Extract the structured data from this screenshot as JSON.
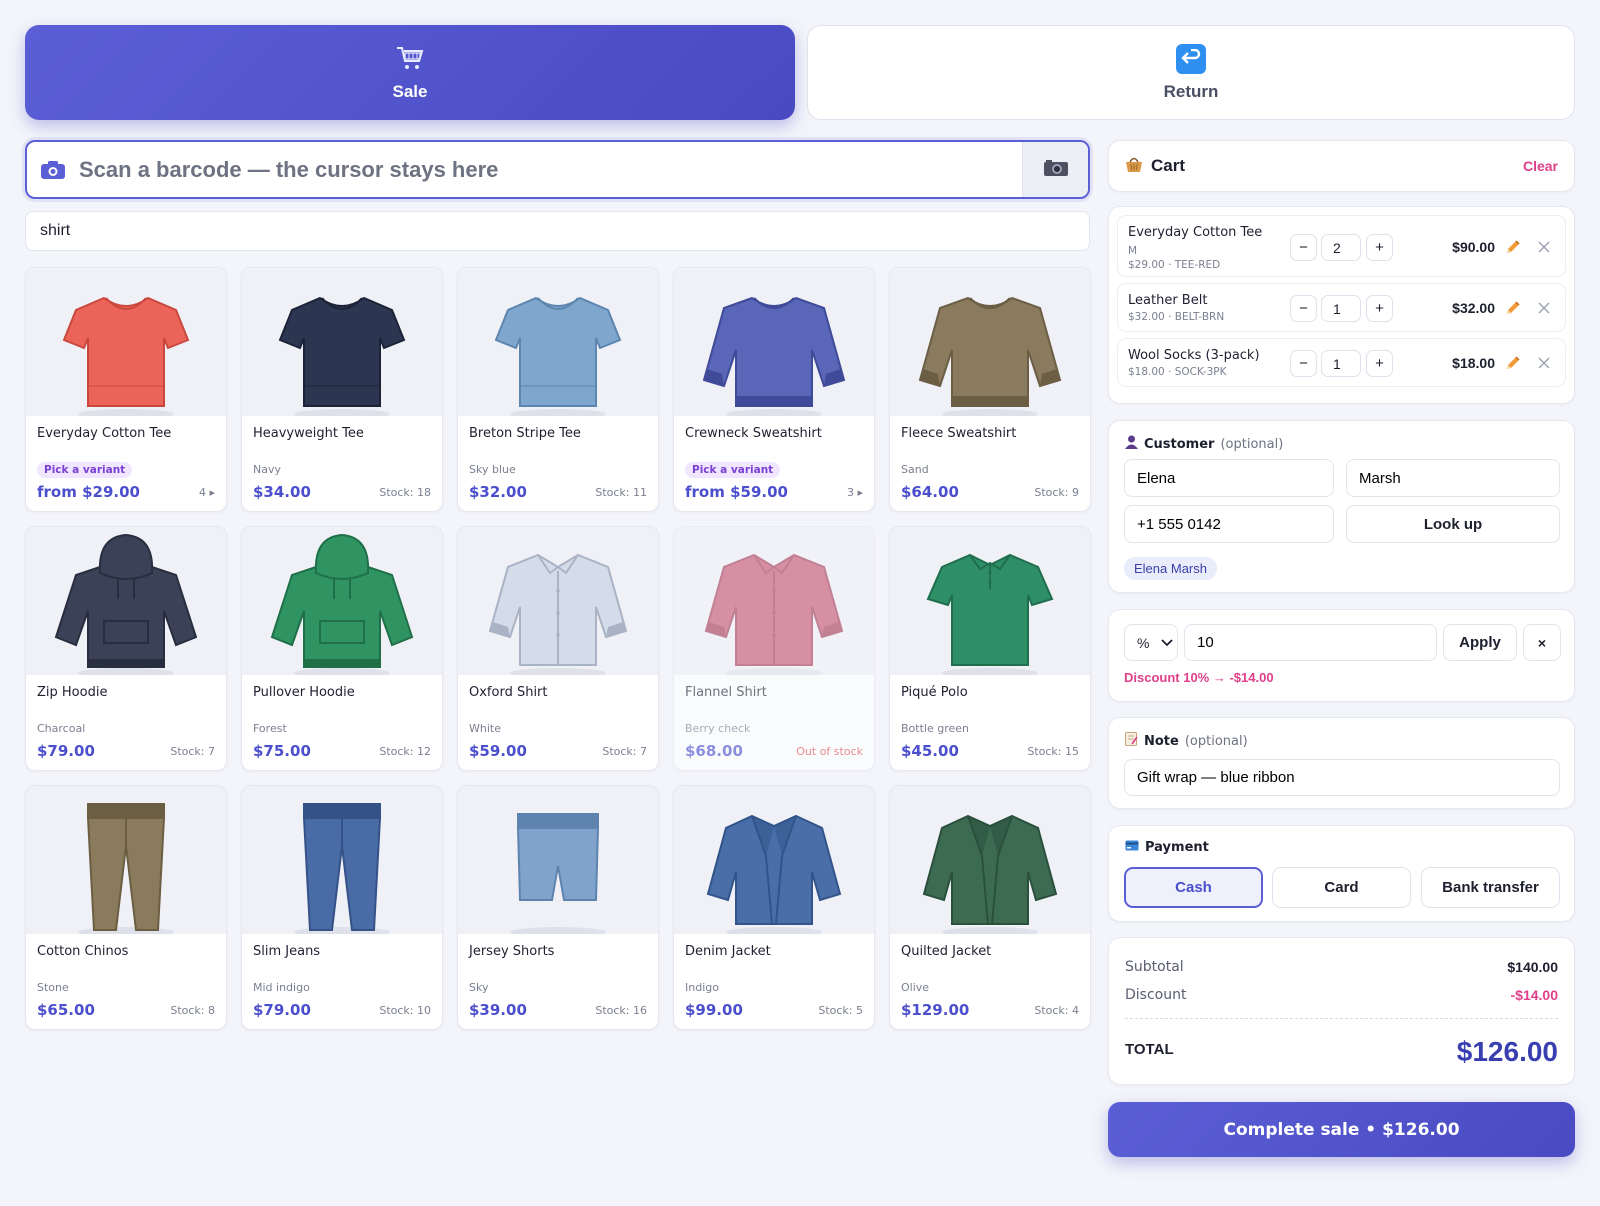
{
  "modes": {
    "sale": {
      "label": "Sale",
      "icon": "shopping-cart-icon",
      "active": true
    },
    "return": {
      "label": "Return",
      "icon": "return-arrow-icon",
      "active": false
    }
  },
  "scan": {
    "placeholder": "Scan a barcode — the cursor stays here",
    "icon": "camera-icon",
    "button_icon": "camera-icon"
  },
  "search": {
    "value": "shirt"
  },
  "products": [
    {
      "name": "Everyday Cotton Tee",
      "badge": "Pick a variant",
      "price": "from $29.00",
      "stock": "4 ▸",
      "shape": "tee",
      "color": "#ec6459",
      "dark": "#c9483e"
    },
    {
      "name": "Heavyweight Tee",
      "variant": "Navy",
      "price": "$34.00",
      "stock": "Stock: 18",
      "shape": "tee",
      "color": "#2d3650",
      "dark": "#1c2338"
    },
    {
      "name": "Breton Stripe Tee",
      "variant": "Sky blue",
      "price": "$32.00",
      "stock": "Stock: 11",
      "shape": "tee",
      "color": "#7fa6cc",
      "dark": "#5c86b0"
    },
    {
      "name": "Crewneck Sweatshirt",
      "badge": "Pick a variant",
      "price": "from $59.00",
      "stock": "3 ▸",
      "shape": "sweat",
      "color": "#5a66b8",
      "dark": "#3f4a98"
    },
    {
      "name": "Fleece Sweatshirt",
      "variant": "Sand",
      "price": "$64.00",
      "stock": "Stock: 9",
      "shape": "sweat",
      "color": "#8a7b5e",
      "dark": "#6b5e44"
    },
    {
      "name": "Zip Hoodie",
      "variant": "Charcoal",
      "price": "$79.00",
      "stock": "Stock: 7",
      "shape": "hoodie",
      "color": "#3b4257",
      "dark": "#282e3f"
    },
    {
      "name": "Pullover Hoodie",
      "variant": "Forest",
      "price": "$75.00",
      "stock": "Stock: 12",
      "shape": "hoodie",
      "color": "#2f9462",
      "dark": "#1f7048"
    },
    {
      "name": "Oxford Shirt",
      "variant": "White",
      "price": "$59.00",
      "stock": "Stock: 7",
      "shape": "shirt",
      "color": "#d4dcea",
      "dark": "#a9b3c5"
    },
    {
      "name": "Flannel Shirt",
      "variant": "Berry check",
      "price": "$68.00",
      "stock": "Out of stock",
      "out": true,
      "shape": "shirt",
      "color": "#c6516f",
      "dark": "#a23a56"
    },
    {
      "name": "Piqué Polo",
      "variant": "Bottle green",
      "price": "$45.00",
      "stock": "Stock: 15",
      "shape": "polo",
      "color": "#2e8f66",
      "dark": "#1f6e4d"
    },
    {
      "name": "Cotton Chinos",
      "variant": "Stone",
      "price": "$65.00",
      "stock": "Stock: 8",
      "shape": "pants",
      "color": "#8a7b5c",
      "dark": "#6b5e43"
    },
    {
      "name": "Slim Jeans",
      "variant": "Mid indigo",
      "price": "$79.00",
      "stock": "Stock: 10",
      "shape": "pants",
      "color": "#4a6ca6",
      "dark": "#345287"
    },
    {
      "name": "Jersey Shorts",
      "variant": "Sky",
      "price": "$39.00",
      "stock": "Stock: 16",
      "shape": "shorts",
      "color": "#7fa3cb",
      "dark": "#5d83ae"
    },
    {
      "name": "Denim Jacket",
      "variant": "Indigo",
      "price": "$99.00",
      "stock": "Stock: 5",
      "shape": "jacket",
      "color": "#4a6fa8",
      "dark": "#32548a"
    },
    {
      "name": "Quilted Jacket",
      "variant": "Olive",
      "price": "$129.00",
      "stock": "Stock: 4",
      "shape": "jacket",
      "color": "#3c6b52",
      "dark": "#2a503c"
    }
  ],
  "cart": {
    "title": "Cart",
    "icon": "basket-icon",
    "clear_label": "Clear",
    "lines": [
      {
        "name": "Everyday Cotton Tee",
        "variant": "M",
        "meta": "$29.00 · TEE-RED",
        "qty": "2",
        "total": "$90.00"
      },
      {
        "name": "Leather Belt",
        "meta": "$32.00 · BELT-BRN",
        "qty": "1",
        "total": "$32.00"
      },
      {
        "name": "Wool Socks (3-pack)",
        "meta": "$18.00 · SOCK-3PK",
        "qty": "1",
        "total": "$18.00"
      }
    ],
    "minus": "−",
    "plus": "+"
  },
  "customer": {
    "title": "Customer",
    "optional": "(optional)",
    "first_name": "Elena",
    "last_name": "Marsh",
    "phone": "+1 555 0142",
    "lookup_label": "Look up",
    "chip": "Elena Marsh"
  },
  "discount": {
    "type": "%",
    "value": "10",
    "apply_label": "Apply",
    "clear_label": "×",
    "summary": "Discount 10% → -$14.00"
  },
  "note": {
    "title": "Note",
    "optional": "(optional)",
    "value": "Gift wrap — blue ribbon"
  },
  "payment": {
    "title": "Payment",
    "methods": [
      "Cash",
      "Card",
      "Bank transfer"
    ],
    "selected": "Cash"
  },
  "totals": {
    "subtotal_label": "Subtotal",
    "subtotal": "$140.00",
    "discount_label": "Discount",
    "discount": "-$14.00",
    "total_label": "TOTAL",
    "total": "$126.00"
  },
  "complete_label": "Complete sale • $126.00",
  "colors": {
    "accent": "#5b5fd6",
    "price": "#4b4fce",
    "danger": "#e0408a",
    "out_of_stock": "#e04a4a"
  }
}
